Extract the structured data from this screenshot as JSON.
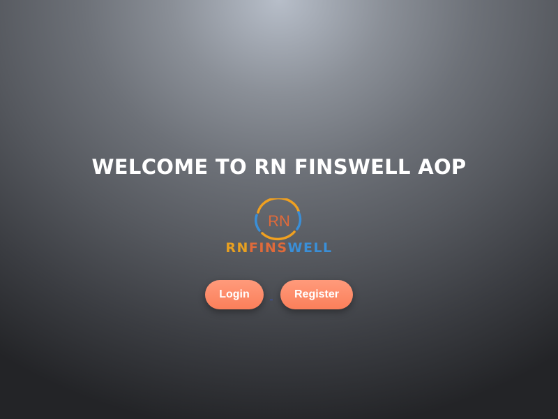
{
  "page": {
    "title": "WELCOME TO RN FINSWELL AOP"
  },
  "logo": {
    "monogram": "RN",
    "word_rn": "RN",
    "word_fins": "FINS",
    "word_well": "WELL",
    "colors": {
      "ring_orange": "#f0a020",
      "ring_blue": "#3a8fd8",
      "monogram": "#e06a3a",
      "rn": "#e8a020",
      "fins": "#e06a3a",
      "well": "#3a8fd8"
    }
  },
  "actions": {
    "login_label": "Login",
    "register_label": "Register"
  },
  "colors": {
    "button": "#fb8a66",
    "title": "#ffffff"
  }
}
